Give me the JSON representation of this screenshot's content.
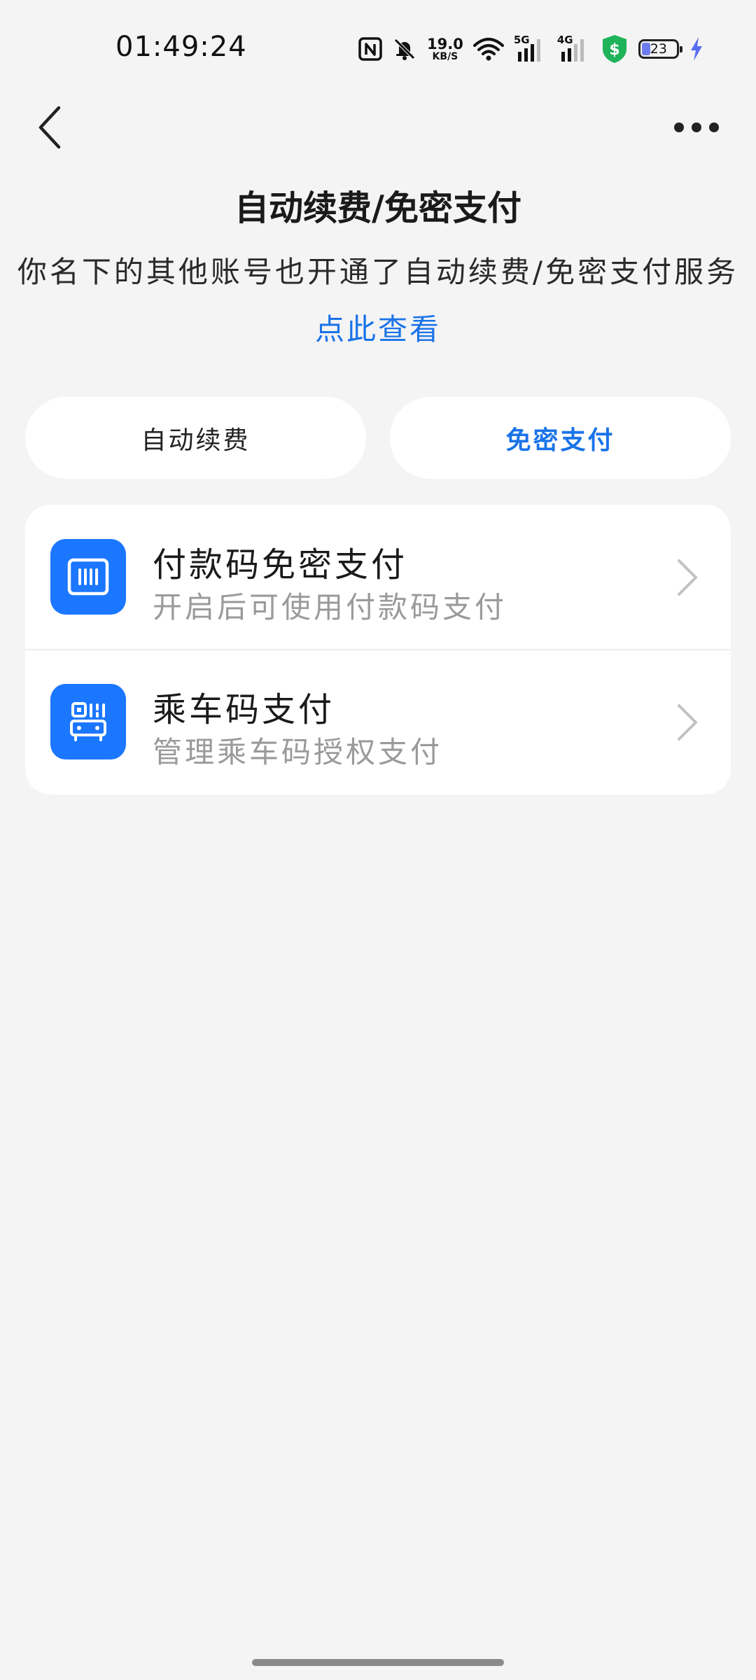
{
  "status_bar": {
    "time": "01:49:24",
    "net_speed_value": "19.0",
    "net_speed_unit": "KB/S",
    "signal1_tag": "5G",
    "signal2_tag": "4G",
    "battery_level": "23",
    "icons": [
      "nfc-icon",
      "bell-muted-icon",
      "wifi-icon",
      "signal-5g-icon",
      "signal-4g-icon",
      "shield-dollar-icon",
      "battery-icon",
      "charging-bolt-icon"
    ]
  },
  "nav": {
    "back_icon": "chevron-left-icon",
    "more_icon": "more-dots-icon"
  },
  "page": {
    "title": "自动续费/免密支付",
    "notice": "你名下的其他账号也开通了自动续费/免密支付服务",
    "notice_link": "点此查看"
  },
  "tabs": [
    {
      "label": "自动续费",
      "active": false
    },
    {
      "label": "免密支付",
      "active": true
    }
  ],
  "list": {
    "items": [
      {
        "title": "付款码免密支付",
        "subtitle": "开启后可使用付款码支付",
        "icon": "payment-code-icon"
      },
      {
        "title": "乘车码支付",
        "subtitle": "管理乘车码授权支付",
        "icon": "transit-code-icon"
      }
    ]
  },
  "colors": {
    "accent": "#1a73e8",
    "icon_bg": "#1b77ff",
    "page_bg": "#f4f4f4",
    "card_bg": "#ffffff",
    "subtitle": "#9a9a9a"
  }
}
